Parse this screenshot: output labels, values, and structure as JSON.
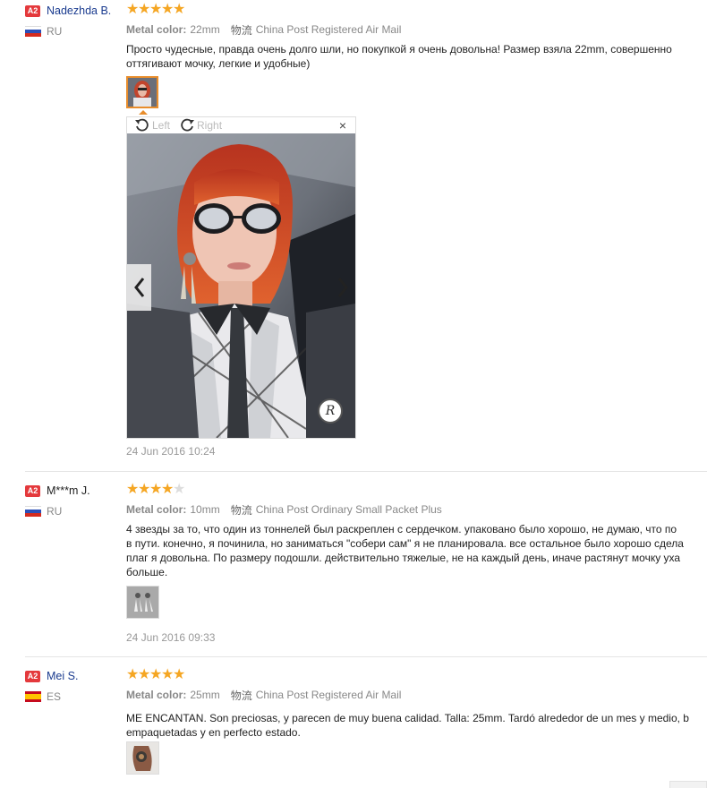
{
  "level_badge": "A2",
  "labels": {
    "metal_color": "Metal color:",
    "shipping_tag": "物流"
  },
  "viewer": {
    "rotate_left": "Left",
    "rotate_right": "Right",
    "close": "×"
  },
  "colors": {
    "accent_star": "#f5a623",
    "badge": "#e4393c",
    "name_link": "#1a3b8f"
  },
  "reviews": [
    {
      "buyer": "Nadezhda B.",
      "country": "RU",
      "rating": 5,
      "metal_color": "22mm",
      "shipping": "China Post Registered Air Mail",
      "text": "Просто чудесные, правда очень долго шли, но покупкой я очень довольна! Размер взяла 22mm, совершенно\nоттягивают мочку, легкие и удобные)",
      "date": "24 Jun 2016 10:24"
    },
    {
      "buyer": "M***m J.",
      "country": "RU",
      "rating": 4,
      "metal_color": "10mm",
      "shipping": "China Post Ordinary Small Packet Plus",
      "text": "4 звезды за то, что один из тоннелей был раскреплен с сердечком. упаковано было хорошо, не думаю, что по\nв пути. конечно, я починила, но заниматься \"собери сам\" я не планировала. все остальное было хорошо сдела\nплаг я довольна. По размеру подошли. действительно тяжелые, не на каждый день, иначе растянут мочку уха\nбольше.",
      "date": "24 Jun 2016 09:33"
    },
    {
      "buyer": "Mei S.",
      "country": "ES",
      "rating": 5,
      "metal_color": "25mm",
      "shipping": "China Post Registered Air Mail",
      "text": "ME ENCANTAN. Son preciosas, y parecen de muy buena calidad. Talla: 25mm. Tardó alrededor de un mes y medio, b\nempaquetadas y en perfecto estado."
    }
  ]
}
